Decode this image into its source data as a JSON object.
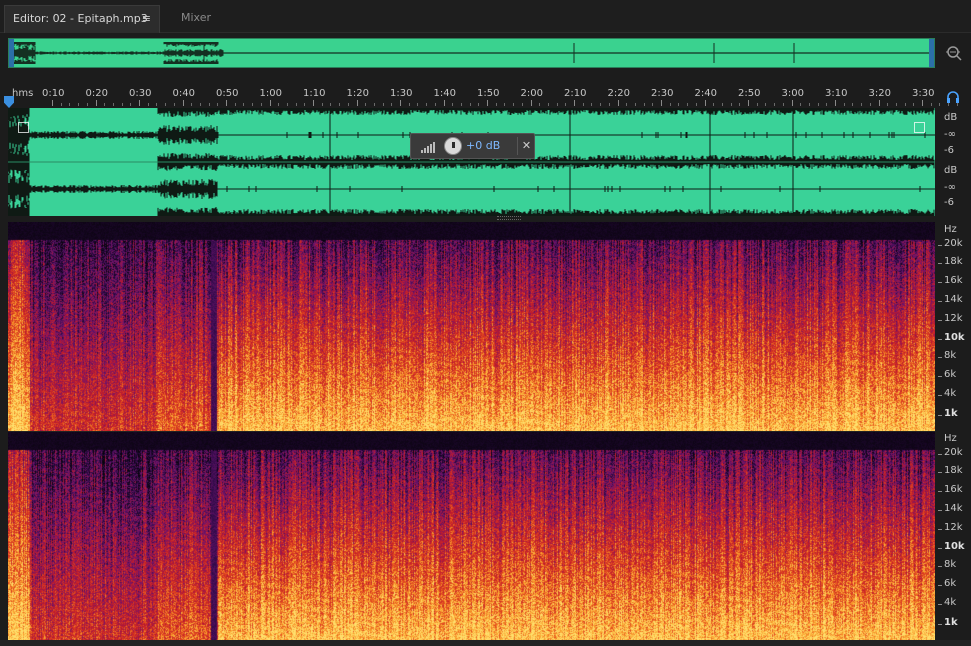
{
  "tabs": {
    "editor_label": "Editor: 02 - Epitaph.mp3",
    "mixer_label": "Mixer",
    "menu_glyph": "≡"
  },
  "ruler": {
    "labels": [
      "hms",
      "0:10",
      "0:20",
      "0:30",
      "0:40",
      "0:50",
      "1:00",
      "1:10",
      "1:20",
      "1:30",
      "1:40",
      "1:50",
      "2:00",
      "2:10",
      "2:20",
      "2:30",
      "2:40",
      "2:50",
      "3:00",
      "3:10",
      "3:20",
      "3:30"
    ]
  },
  "hud": {
    "gain_label": "+0 dB",
    "pin_glyph": "✕"
  },
  "amp_scale": {
    "ch1": [
      "dB",
      "-∞",
      "-6"
    ],
    "ch2": [
      "dB",
      "-∞",
      "-6"
    ]
  },
  "freq_scale": {
    "labels": [
      "Hz",
      "20k",
      "18k",
      "16k",
      "14k",
      "12k",
      "10k",
      "8k",
      "6k",
      "4k",
      "1k"
    ]
  },
  "icons": {
    "zoom": "zoom-selection-icon",
    "headphones": "headphones-icon",
    "level_bars": "level-meter-icon",
    "pin": "pin-icon"
  },
  "colors": {
    "waveform_bg": "#3ad298",
    "waveform": "#0f1a14",
    "accent": "#3b8fe0",
    "spectral_low": "#2b0a3b",
    "spectral_mid": "#c0202a",
    "spectral_high": "#ffd35a"
  }
}
